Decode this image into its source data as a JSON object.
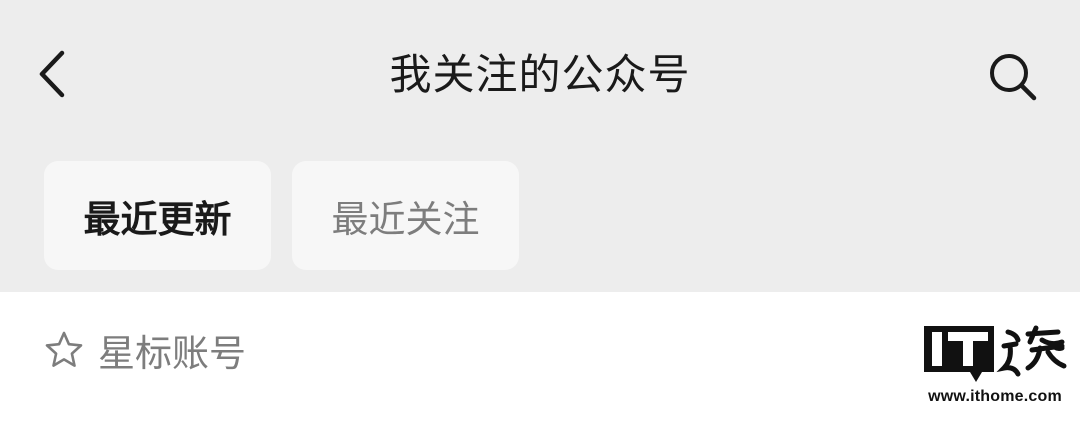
{
  "header": {
    "title": "我关注的公众号",
    "back_icon": "chevron-left-icon",
    "search_icon": "search-icon"
  },
  "tabs": [
    {
      "label": "最近更新",
      "selected": true
    },
    {
      "label": "最近关注",
      "selected": false
    }
  ],
  "starred": {
    "icon": "star-outline-icon",
    "label": "星标账号"
  },
  "watermark": {
    "logo_text": "IT之家",
    "url": "www.ithome.com"
  },
  "colors": {
    "header_bg": "#ededed",
    "tab_bg": "#f7f7f7",
    "primary_text": "#1a1a1a",
    "secondary_text": "#7d7d7d",
    "list_bg": "#ffffff"
  }
}
